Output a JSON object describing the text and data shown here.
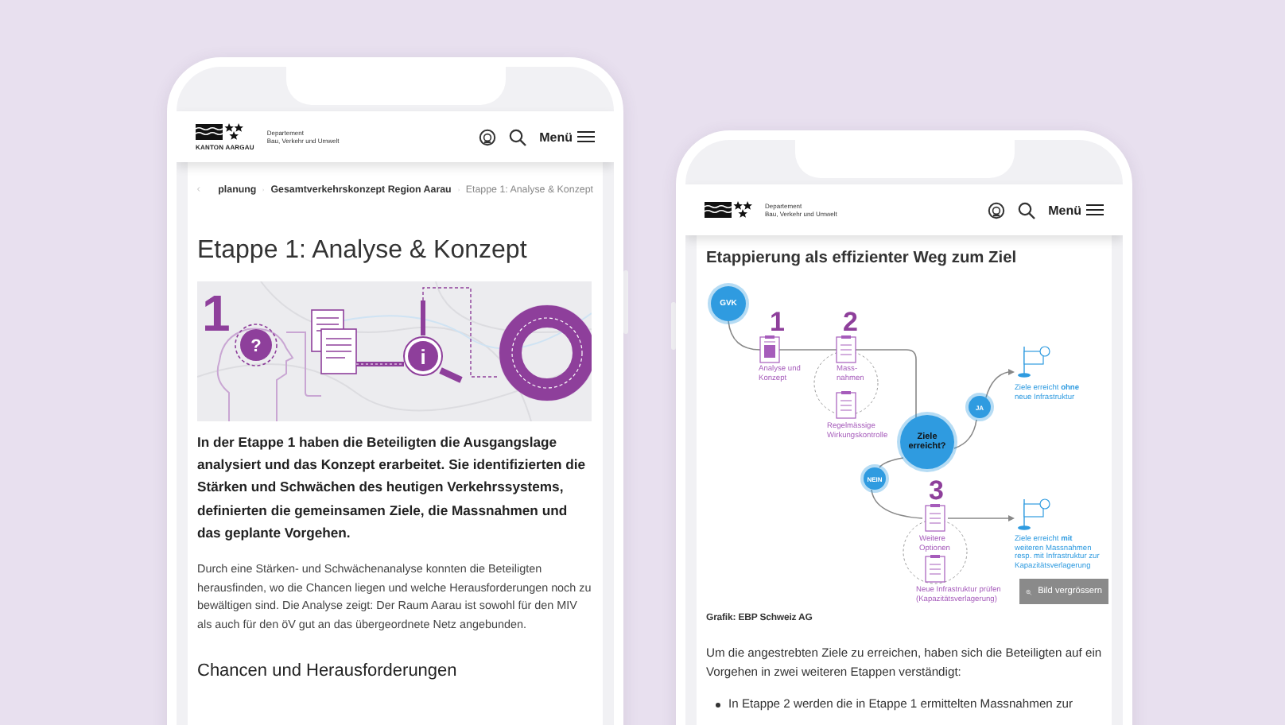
{
  "left_phone": {
    "header": {
      "logo_caption": "KANTON AARGAU",
      "department": "Departement",
      "department_name": "Bau, Verkehr und Umwelt",
      "menu_label": "Menü"
    },
    "breadcrumb": [
      {
        "label": "planung",
        "current": false
      },
      {
        "label": "Gesamtverkehrskonzept Region Aarau",
        "current": false
      },
      {
        "label": "Etappe 1: Analyse & Konzept",
        "current": true
      }
    ],
    "title": "Etappe 1: Analyse & Konzept",
    "hero": {
      "number": "1",
      "question_mark": "?",
      "info_mark": "i"
    },
    "lead": "In der Etappe 1 haben die Beteiligten die Ausgangslage analysiert und das Konzept erarbeitet. Sie identifizierten die Stärken und Schwächen des heutigen Verkehrssystems, definierten die gemeinsamen Ziele, die Massnahmen und das geplante Vorgehen.",
    "body": "Durch eine Stärken- und Schwächenanalyse konnten die Beteiligten herausfinden, wo die Chancen liegen und welche Herausforderungen noch zu bewältigen sind. Die Analyse zeigt: Der Raum Aarau ist sowohl für den MIV als auch für den öV gut an das übergeordnete Netz angebunden.",
    "heading": "Chancen und Herausforderungen"
  },
  "right_phone": {
    "header": {
      "department": "Departement",
      "department_name": "Bau, Verkehr und Umwelt",
      "menu_label": "Menü"
    },
    "title": "Etappierung als effizienter Weg zum Ziel",
    "diagram": {
      "start": "GVK",
      "stage_1": {
        "number": "1",
        "label": "Analyse und\nKonzept"
      },
      "stage_2": {
        "number": "2",
        "label": "Mass-\nnahmen"
      },
      "review": {
        "label": "Regelmässige\nWirkungskontrolle"
      },
      "decision": {
        "label": "Ziele\nerreicht?"
      },
      "yes": {
        "label": "JA"
      },
      "outcome_yes": {
        "label": "Ziele erreicht **ohne**\nneue Infrastruktur"
      },
      "no": {
        "label": "NEIN"
      },
      "stage_3": {
        "number": "3",
        "label": "Weitere\nOptionen"
      },
      "option": {
        "label": "Neue Infrastruktur prüfen\n(Kapazitätsverlagerung)"
      },
      "outcome_no": {
        "label": "Ziele erreicht **mit**\nweiteren Massnahmen\nresp. mit Infrastruktur zur\nKapazitätsverlagerung"
      },
      "zoom_button": {
        "label": "Bild vergrössern"
      }
    },
    "credit": "Grafik: EBP Schweiz AG",
    "paragraph": "Um die angestrebten Ziele zu erreichen, haben sich die Beteiligten auf ein Vorgehen in zwei weiteren Etappen verständigt:",
    "bullets": [
      "In Etappe 2 werden die in Etappe 1 ermittelten Massnahmen zur"
    ]
  }
}
